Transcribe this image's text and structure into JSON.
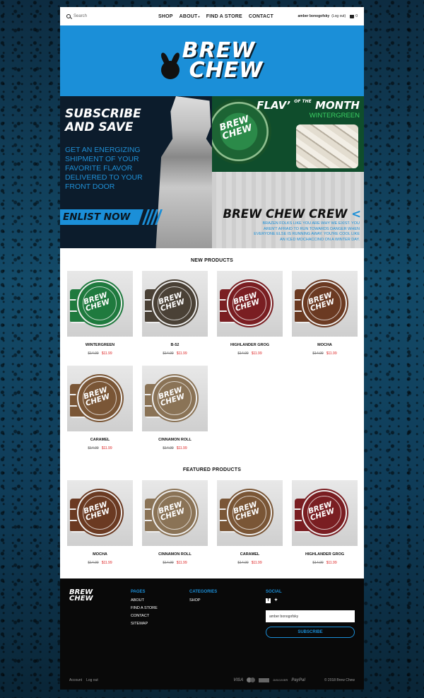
{
  "header": {
    "search_placeholder": "Search",
    "nav": [
      {
        "label": "SHOP"
      },
      {
        "label": "ABOUT",
        "has_dropdown": true
      },
      {
        "label": "FIND A STORE"
      },
      {
        "label": "CONTACT"
      }
    ],
    "user_name": "amber bonogofsky",
    "logout_label": "(Log out)",
    "cart_count": "0"
  },
  "brand": {
    "logo_line1": "BREW",
    "logo_line2": "CHEW",
    "band_color": "#1b8fd8"
  },
  "promo": {
    "subscribe_title_1": "SUBSCRIBE",
    "subscribe_title_2": "AND SAVE",
    "subscribe_desc": "GET AN ENERGIZING SHIPMENT OF YOUR FAVORITE FLAVOR DELIVERED TO YOUR FRONT DOOR",
    "enlist_label": "ENLIST NOW",
    "flav_title": "FLAV",
    "flav_sup": "OF THE",
    "flav_month": "MONTH",
    "flav_flavor": "WINTERGREEN",
    "can_text_1": "BREW",
    "can_text_2": "CHEW",
    "crew_title": "BREW CHEW CREW",
    "crew_arrow": "<",
    "crew_desc": "BRAZEN FOLKS LIKE YOU ARE WHY WE EXIST. YOU AREN'T AFRAID TO RUN TOWARDS DANGER WHEN EVERYONE ELSE IS RUNNING AWAY. YOU'RE COOL LIKE AN ICED MOCHACCINO ON A WINTER DAY."
  },
  "new_products": {
    "title": "NEW PRODUCTS",
    "items": [
      {
        "name": "WINTERGREEN",
        "old_price": "$14.99",
        "price": "$11.99",
        "color": "#1f7a3e"
      },
      {
        "name": "B-52",
        "old_price": "$14.99",
        "price": "$11.99",
        "color": "#4a4136"
      },
      {
        "name": "HIGHLANDER GROG",
        "old_price": "$14.99",
        "price": "$11.99",
        "color": "#7a1e22"
      },
      {
        "name": "MOCHA",
        "old_price": "$14.99",
        "price": "$11.99",
        "color": "#6b3a22"
      },
      {
        "name": "CARAMEL",
        "old_price": "$14.99",
        "price": "$11.99",
        "color": "#7a5636"
      },
      {
        "name": "CINNAMON ROLL",
        "old_price": "$14.99",
        "price": "$11.99",
        "color": "#8a7356"
      }
    ]
  },
  "featured_products": {
    "title": "FEATURED PRODUCTS",
    "items": [
      {
        "name": "MOCHA",
        "old_price": "$14.99",
        "price": "$11.99",
        "color": "#6b3a22"
      },
      {
        "name": "CINNAMON ROLL",
        "old_price": "$14.99",
        "price": "$11.99",
        "color": "#8a7356"
      },
      {
        "name": "CARAMEL",
        "old_price": "$14.99",
        "price": "$11.99",
        "color": "#7a5636"
      },
      {
        "name": "HIGHLANDER GROG",
        "old_price": "$14.99",
        "price": "$11.99",
        "color": "#7a1e22"
      }
    ]
  },
  "footer": {
    "logo_line1": "BREW",
    "logo_line2": "CHEW",
    "pages_title": "PAGES",
    "pages": [
      "ABOUT",
      "FIND A STORE",
      "CONTACT",
      "SITEMAP"
    ],
    "categories_title": "CATEGORIES",
    "categories": [
      "SHOP"
    ],
    "social_title": "SOCIAL",
    "email_value": "amber bonogofsky",
    "subscribe_label": "SUBSCRIBE",
    "account_label": "Account",
    "logout_label": "Log out",
    "payment": [
      "VISA",
      "DISCOVER",
      "PayPal"
    ],
    "copyright": "© 2018 Brew Chew"
  }
}
